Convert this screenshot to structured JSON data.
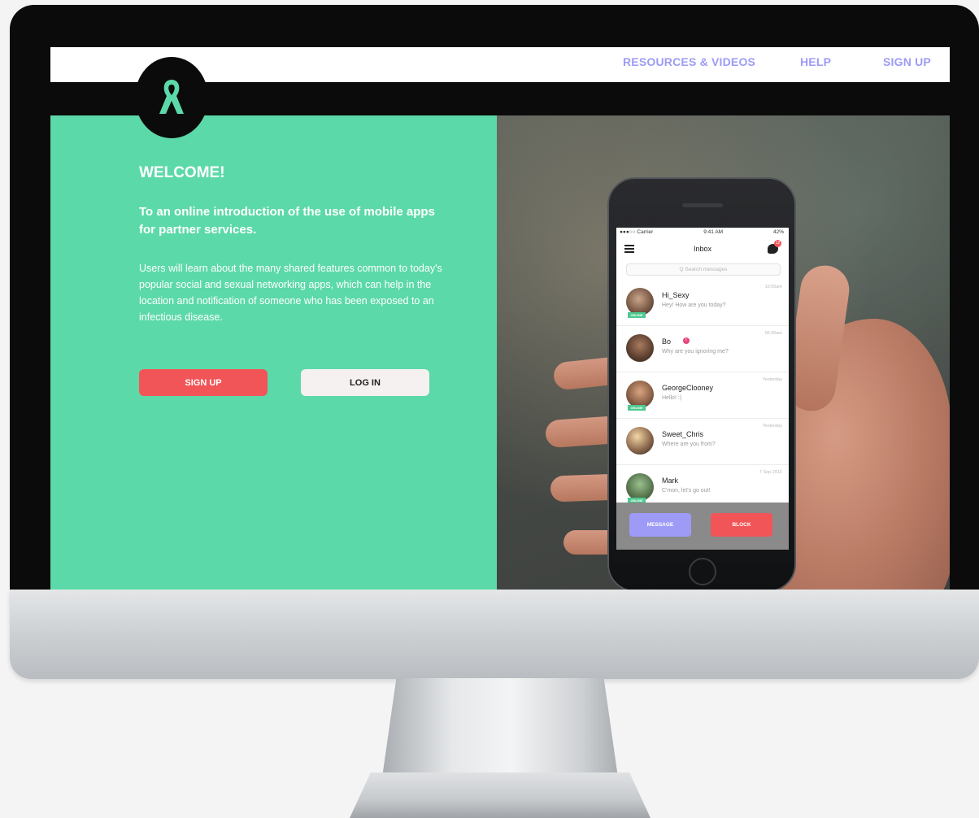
{
  "nav": {
    "resources": "RESOURCES & VIDEOS",
    "help": "HELP",
    "signup": "SIGN UP"
  },
  "hero": {
    "welcome": "WELCOME!",
    "intro": "To an online introduction of the use of mobile apps for partner services.",
    "description": "Users will learn about the many shared features common to today's popular social and sexual networking apps, which can help in the location and notification of someone who has been exposed to an infectious disease.",
    "signup_button": "SIGN UP",
    "login_button": "LOG IN"
  },
  "phone": {
    "status": {
      "carrier": "●●●○○ Carrier",
      "time": "9:41 AM",
      "battery": "42%"
    },
    "title": "Inbox",
    "chat_badge": "12",
    "search_placeholder": "Q Search messages",
    "messages": [
      {
        "name": "Hi_Sexy",
        "text": "Hey! How are you today?",
        "time": "10:05am",
        "online": "ONLINE"
      },
      {
        "name": "Bo",
        "text": "Why are you ignoring me?",
        "time": "06:30am",
        "alert": "!"
      },
      {
        "name": "GeorgeClooney",
        "text": "Hello! :)",
        "time": "Yesterday",
        "online": "ONLINE"
      },
      {
        "name": "Sweet_Chris",
        "text": "Where are you from?",
        "time": "Yesterday"
      },
      {
        "name": "Mark",
        "text": "C'mon, let's go out!",
        "time": "7 Sep 2015",
        "online": "ONLINE"
      }
    ],
    "message_button": "MESSAGE",
    "block_button": "BLOCK"
  },
  "colors": {
    "accent_green": "#5cd9a9",
    "nav_purple": "#9d9bf5",
    "danger_red": "#f25557"
  },
  "icons": [
    "ribbon-icon",
    "menu-icon",
    "chat-icon",
    "search-icon"
  ]
}
